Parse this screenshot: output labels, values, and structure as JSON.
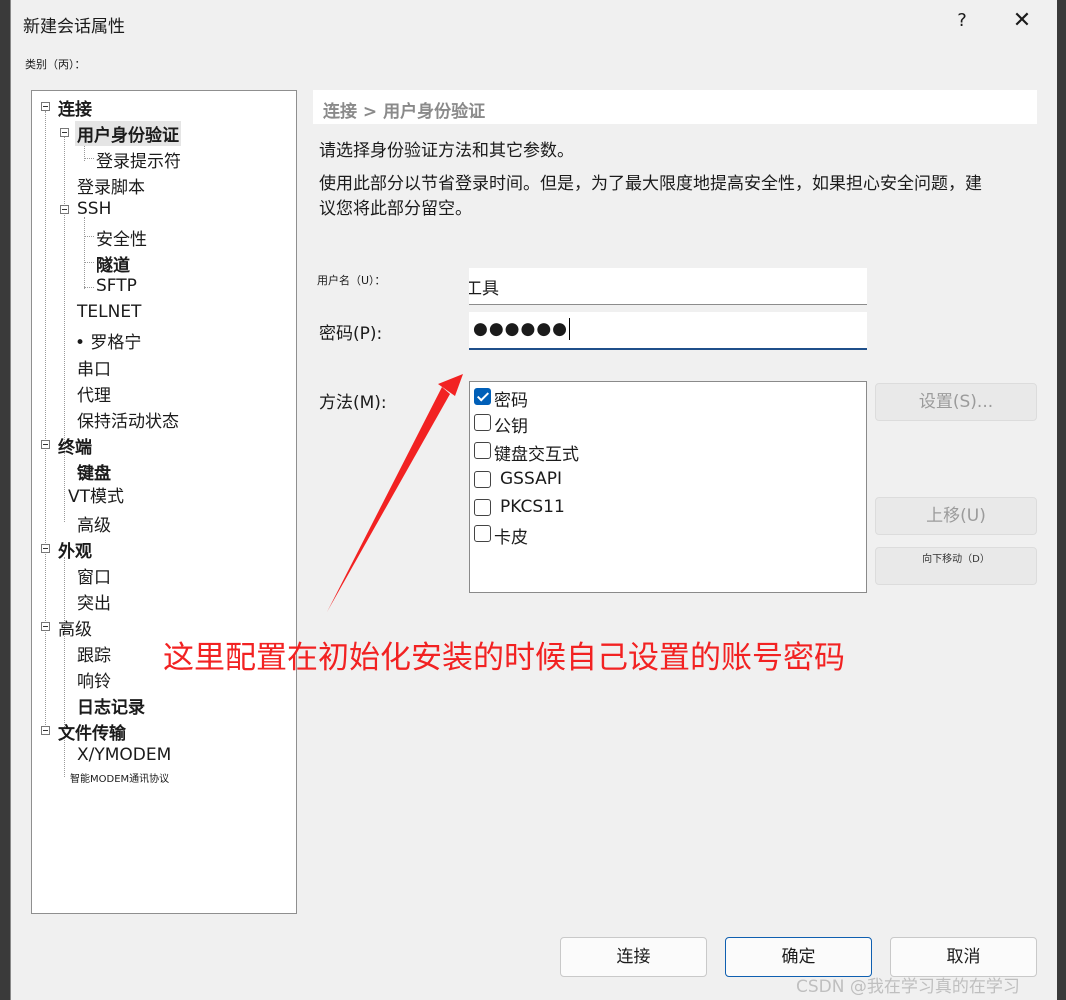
{
  "dialog": {
    "title": "新建会话属性",
    "help": "?",
    "close": "✕",
    "category_label": "类别（丙）："
  },
  "tree": [
    {
      "label": "连接",
      "bold": true
    },
    {
      "label": "用户身份验证",
      "bold": true,
      "selected": true
    },
    {
      "label": "登录提示符"
    },
    {
      "label": "登录脚本"
    },
    {
      "label": "SSH"
    },
    {
      "label": "安全性"
    },
    {
      "label": "隧道",
      "bold": true
    },
    {
      "label": "SFTP"
    },
    {
      "label": "TELNET"
    },
    {
      "label": "• 罗格宁"
    },
    {
      "label": "串口"
    },
    {
      "label": "代理"
    },
    {
      "label": "保持活动状态"
    },
    {
      "label": "终端",
      "bold": true
    },
    {
      "label": "键盘",
      "bold": true
    },
    {
      "label": "VT模式"
    },
    {
      "label": "高级"
    },
    {
      "label": "外观",
      "bold": true
    },
    {
      "label": "窗口"
    },
    {
      "label": "突出"
    },
    {
      "label": "高级"
    },
    {
      "label": "跟踪"
    },
    {
      "label": "响铃"
    },
    {
      "label": "日志记录",
      "bold": true
    },
    {
      "label": "文件传输",
      "bold": true
    },
    {
      "label": "X/YMODEM"
    },
    {
      "label": "智能MODEM通讯协议"
    }
  ],
  "panel": {
    "breadcrumb": "连接 > 用户身份验证",
    "desc1": "请选择身份验证方法和其它参数。",
    "desc2_line1": "使用此部分以节省登录时间。但是，为了最大限度地提高安全性，如果担心安全问题，建",
    "desc2_line2": "议您将此部分留空。",
    "username_label": "用户名（U）：",
    "username_value": "工具",
    "password_label": "密码(P):",
    "password_value": "●●●●●●",
    "method_label": "方法(M):",
    "methods": [
      {
        "label": "密码",
        "checked": true
      },
      {
        "label": "公钥",
        "checked": false
      },
      {
        "label": "键盘交互式",
        "checked": false
      },
      {
        "label": "GSSAPI",
        "checked": false
      },
      {
        "label": "PKCS11",
        "checked": false
      },
      {
        "label": "卡皮",
        "checked": false
      }
    ],
    "settings_button": "设置(S)...",
    "move_up_button": "上移(U)",
    "move_down_button": "向下移动（D）"
  },
  "buttons": {
    "connect": "连接",
    "ok": "确定",
    "cancel": "取消"
  },
  "annotation": "这里配置在初始化安装的时候自己设置的账号密码",
  "watermark": "CSDN @我在学习真的在学习",
  "colors": {
    "annotation": "#f22222",
    "checkbox_accent": "#005fb8"
  }
}
